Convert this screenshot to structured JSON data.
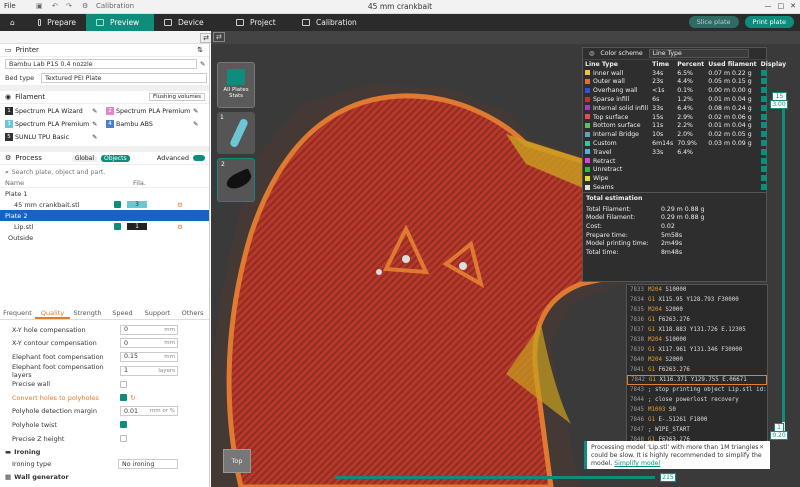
{
  "window": {
    "title": "45 mm crankbait",
    "file_menu": "File",
    "calibration": "Calibration"
  },
  "tabs": [
    {
      "label": "Prepare"
    },
    {
      "label": "Preview"
    },
    {
      "label": "Device"
    },
    {
      "label": "Project"
    },
    {
      "label": "Calibration"
    }
  ],
  "toolbar": {
    "slice_label": "Slice plate",
    "print_label": "Print plate"
  },
  "printer": {
    "section_title": "Printer",
    "name": "Bambu Lab P1S 0.4 nozzle",
    "bed_type_label": "Bed type",
    "bed_type": "Textured PEI Plate"
  },
  "filament": {
    "section_title": "Filament",
    "flushing_btn": "Flushing volumes",
    "items": [
      {
        "num": "1",
        "name": "Spectrum PLA Wizard",
        "color": "#2b2b2b"
      },
      {
        "num": "2",
        "name": "Spectrum PLA Premium",
        "color": "#e089c9"
      },
      {
        "num": "3",
        "name": "Spectrum PLA Premium",
        "color": "#6cc6d6"
      },
      {
        "num": "4",
        "name": "Bambu ABS",
        "color": "#4a7fd0"
      },
      {
        "num": "5",
        "name": "SUNLU TPU Basic",
        "color": "#333333"
      }
    ]
  },
  "process": {
    "section_title": "Process",
    "global": "Global",
    "objects": "Objects",
    "advanced": "Advanced",
    "search_placeholder": "Search plate, object and part.",
    "col_name": "Name",
    "col_fila": "Fila.",
    "tree": [
      {
        "label": "Plate 1"
      },
      {
        "label": "45 mm crankbait.stl",
        "fila": "3"
      },
      {
        "label": "Plate 2"
      },
      {
        "label": "Lip.stl",
        "fila": "1"
      },
      {
        "label": "Outside"
      }
    ]
  },
  "settings_tabs": [
    "Frequent",
    "Quality",
    "Strength",
    "Speed",
    "Support",
    "Others"
  ],
  "settings": [
    {
      "label": "X-Y hole compensation",
      "value": "0",
      "unit": "mm"
    },
    {
      "label": "X-Y contour compensation",
      "value": "0",
      "unit": "mm"
    },
    {
      "label": "Elephant foot compensation",
      "value": "0.15",
      "unit": "mm"
    },
    {
      "label": "Elephant foot compensation layers",
      "value": "1",
      "unit": "layers"
    },
    {
      "label": "Precise wall"
    },
    {
      "label": "Convert holes to polyholes"
    },
    {
      "label": "Polyhole detection margin",
      "value": "0.01",
      "unit": "mm or %"
    },
    {
      "label": "Polyhole twist"
    },
    {
      "label": "Precise Z height"
    }
  ],
  "ironing": {
    "title": "Ironing",
    "type_label": "Ironing type",
    "type_value": "No ironing"
  },
  "wall_gen": "Wall generator",
  "plates_panel": {
    "all_label": "All Plates Stats",
    "p1": "1",
    "p2": "2"
  },
  "color_scheme": {
    "label": "Color scheme",
    "value": "Line Type",
    "headers": [
      "Line Type",
      "Time",
      "Percent",
      "Used filament",
      "Display"
    ],
    "rows": [
      {
        "name": "Inner wall",
        "color": "#f0c040",
        "time": "34s",
        "pct": "6.5%",
        "len": "0.07 m",
        "wt": "0.22 g"
      },
      {
        "name": "Outer wall",
        "color": "#e07030",
        "time": "23s",
        "pct": "4.4%",
        "len": "0.05 m",
        "wt": "0.15 g"
      },
      {
        "name": "Overhang wall",
        "color": "#3050e0",
        "time": "<1s",
        "pct": "0.1%",
        "len": "0.00 m",
        "wt": "0.00 g"
      },
      {
        "name": "Sparse infill",
        "color": "#c03030",
        "time": "6s",
        "pct": "1.2%",
        "len": "0.01 m",
        "wt": "0.04 g"
      },
      {
        "name": "Internal solid infill",
        "color": "#a040c0",
        "time": "33s",
        "pct": "6.4%",
        "len": "0.08 m",
        "wt": "0.24 g"
      },
      {
        "name": "Top surface",
        "color": "#e05050",
        "time": "15s",
        "pct": "2.9%",
        "len": "0.02 m",
        "wt": "0.06 g"
      },
      {
        "name": "Bottom surface",
        "color": "#60c060",
        "time": "11s",
        "pct": "2.2%",
        "len": "0.01 m",
        "wt": "0.04 g"
      },
      {
        "name": "Internal Bridge",
        "color": "#60a0c0",
        "time": "10s",
        "pct": "2.0%",
        "len": "0.02 m",
        "wt": "0.05 g"
      },
      {
        "name": "Custom",
        "color": "#40c0a0",
        "time": "6m14s",
        "pct": "70.9%",
        "len": "0.03 m",
        "wt": "0.09 g"
      },
      {
        "name": "Travel",
        "color": "#50b0e0",
        "time": "33s",
        "pct": "6.4%",
        "len": "",
        "wt": ""
      },
      {
        "name": "Retract",
        "color": "#e040e0",
        "time": "",
        "pct": "",
        "len": "",
        "wt": ""
      },
      {
        "name": "Unretract",
        "color": "#30c030",
        "time": "",
        "pct": "",
        "len": "",
        "wt": ""
      },
      {
        "name": "Wipe",
        "color": "#e0e030",
        "time": "",
        "pct": "",
        "len": "",
        "wt": ""
      },
      {
        "name": "Seams",
        "color": "#e0e0e0",
        "time": "",
        "pct": "",
        "len": "",
        "wt": ""
      }
    ]
  },
  "estimation": {
    "title": "Total estimation",
    "rows": [
      {
        "k": "Total Filament:",
        "v": "0.29 m    0.88 g"
      },
      {
        "k": "Model Filament:",
        "v": "0.29 m    0.88 g"
      },
      {
        "k": "Cost:",
        "v": "0.02"
      },
      {
        "k": "Prepare time:",
        "v": "5m58s"
      },
      {
        "k": "Model printing time:",
        "v": "2m49s"
      },
      {
        "k": "Total time:",
        "v": "8m48s"
      }
    ]
  },
  "gcode": [
    {
      "n": "7833",
      "c": "M204",
      "a": " S10000"
    },
    {
      "n": "7834",
      "c": "G1",
      "a": " X115.95 Y128.793 F30000"
    },
    {
      "n": "7835",
      "c": "M204",
      "a": " S2000"
    },
    {
      "n": "7836",
      "c": "G1",
      "a": " F6263.276"
    },
    {
      "n": "7837",
      "c": "G1",
      "a": " X118.883 Y131.726 E.12305"
    },
    {
      "n": "7838",
      "c": "M204",
      "a": " S10000"
    },
    {
      "n": "7839",
      "c": "G1",
      "a": " X117.961 Y131.346 F30000"
    },
    {
      "n": "7840",
      "c": "M204",
      "a": " S2000"
    },
    {
      "n": "7841",
      "c": "G1",
      "a": " F6263.276"
    },
    {
      "n": "7842",
      "c": "G1",
      "a": " X116.371 Y129.755 E.06671"
    },
    {
      "n": "7843",
      "c": "",
      "a": "; stop printing object Lip.stl id:22 copy 0"
    },
    {
      "n": "7844",
      "c": "",
      "a": "; close powerlost recovery"
    },
    {
      "n": "7845",
      "c": "M1003",
      "a": " S0"
    },
    {
      "n": "7846",
      "c": "G1",
      "a": " E-.51261 F1800"
    },
    {
      "n": "7847",
      "c": "",
      "a": "; WIPE_START"
    },
    {
      "n": "7848",
      "c": "G1",
      "a": " F6263.276"
    },
    {
      "n": "7849",
      "c": "G1",
      "a": " X117.078 Y130.463 E-.28739"
    },
    {
      "n": "7850",
      "c": "",
      "a": "; WIPE_END"
    }
  ],
  "toast": {
    "text": "Processing model 'Lip.stl' with more than 1M triangles could be slow. It is highly recommended to simplify the model.",
    "link": "Simplify model"
  },
  "layer_slider": {
    "top_value": "15",
    "top_height": "3.00",
    "bottom_value": "1",
    "bottom_height": "0.20"
  },
  "move_slider": {
    "value": "215"
  },
  "view_cube": "Top",
  "colors": {
    "accent": "#0f8d7c",
    "model": "#c53a2a",
    "outline": "#e07a30"
  }
}
